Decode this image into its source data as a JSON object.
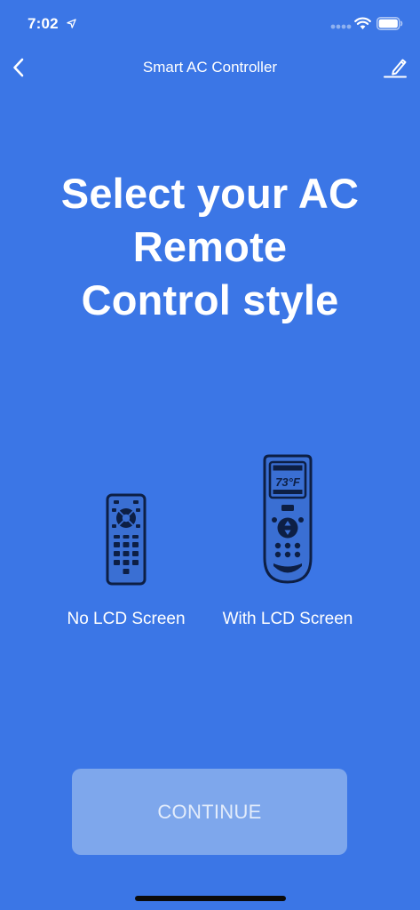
{
  "status_bar": {
    "time": "7:02",
    "icons": [
      "location-arrow-icon",
      "cellular-signal-icon",
      "wifi-icon",
      "battery-icon"
    ]
  },
  "nav": {
    "title": "Smart AC Controller",
    "back_icon": "chevron-left-icon",
    "edit_icon": "pencil-icon"
  },
  "headline": "Select your AC Remote Control style",
  "options": [
    {
      "label": "No LCD Screen",
      "icon": "remote-no-lcd-icon"
    },
    {
      "label": "With LCD Screen",
      "icon": "remote-with-lcd-icon",
      "display_value": "73°F"
    }
  ],
  "continue_label": "CONTINUE",
  "colors": {
    "background": "#3b76e6",
    "button": "#7ea7ec",
    "button_text": "#e3ecfb",
    "remote_body": "#3a6fd3",
    "remote_outline": "#0d1f45"
  }
}
